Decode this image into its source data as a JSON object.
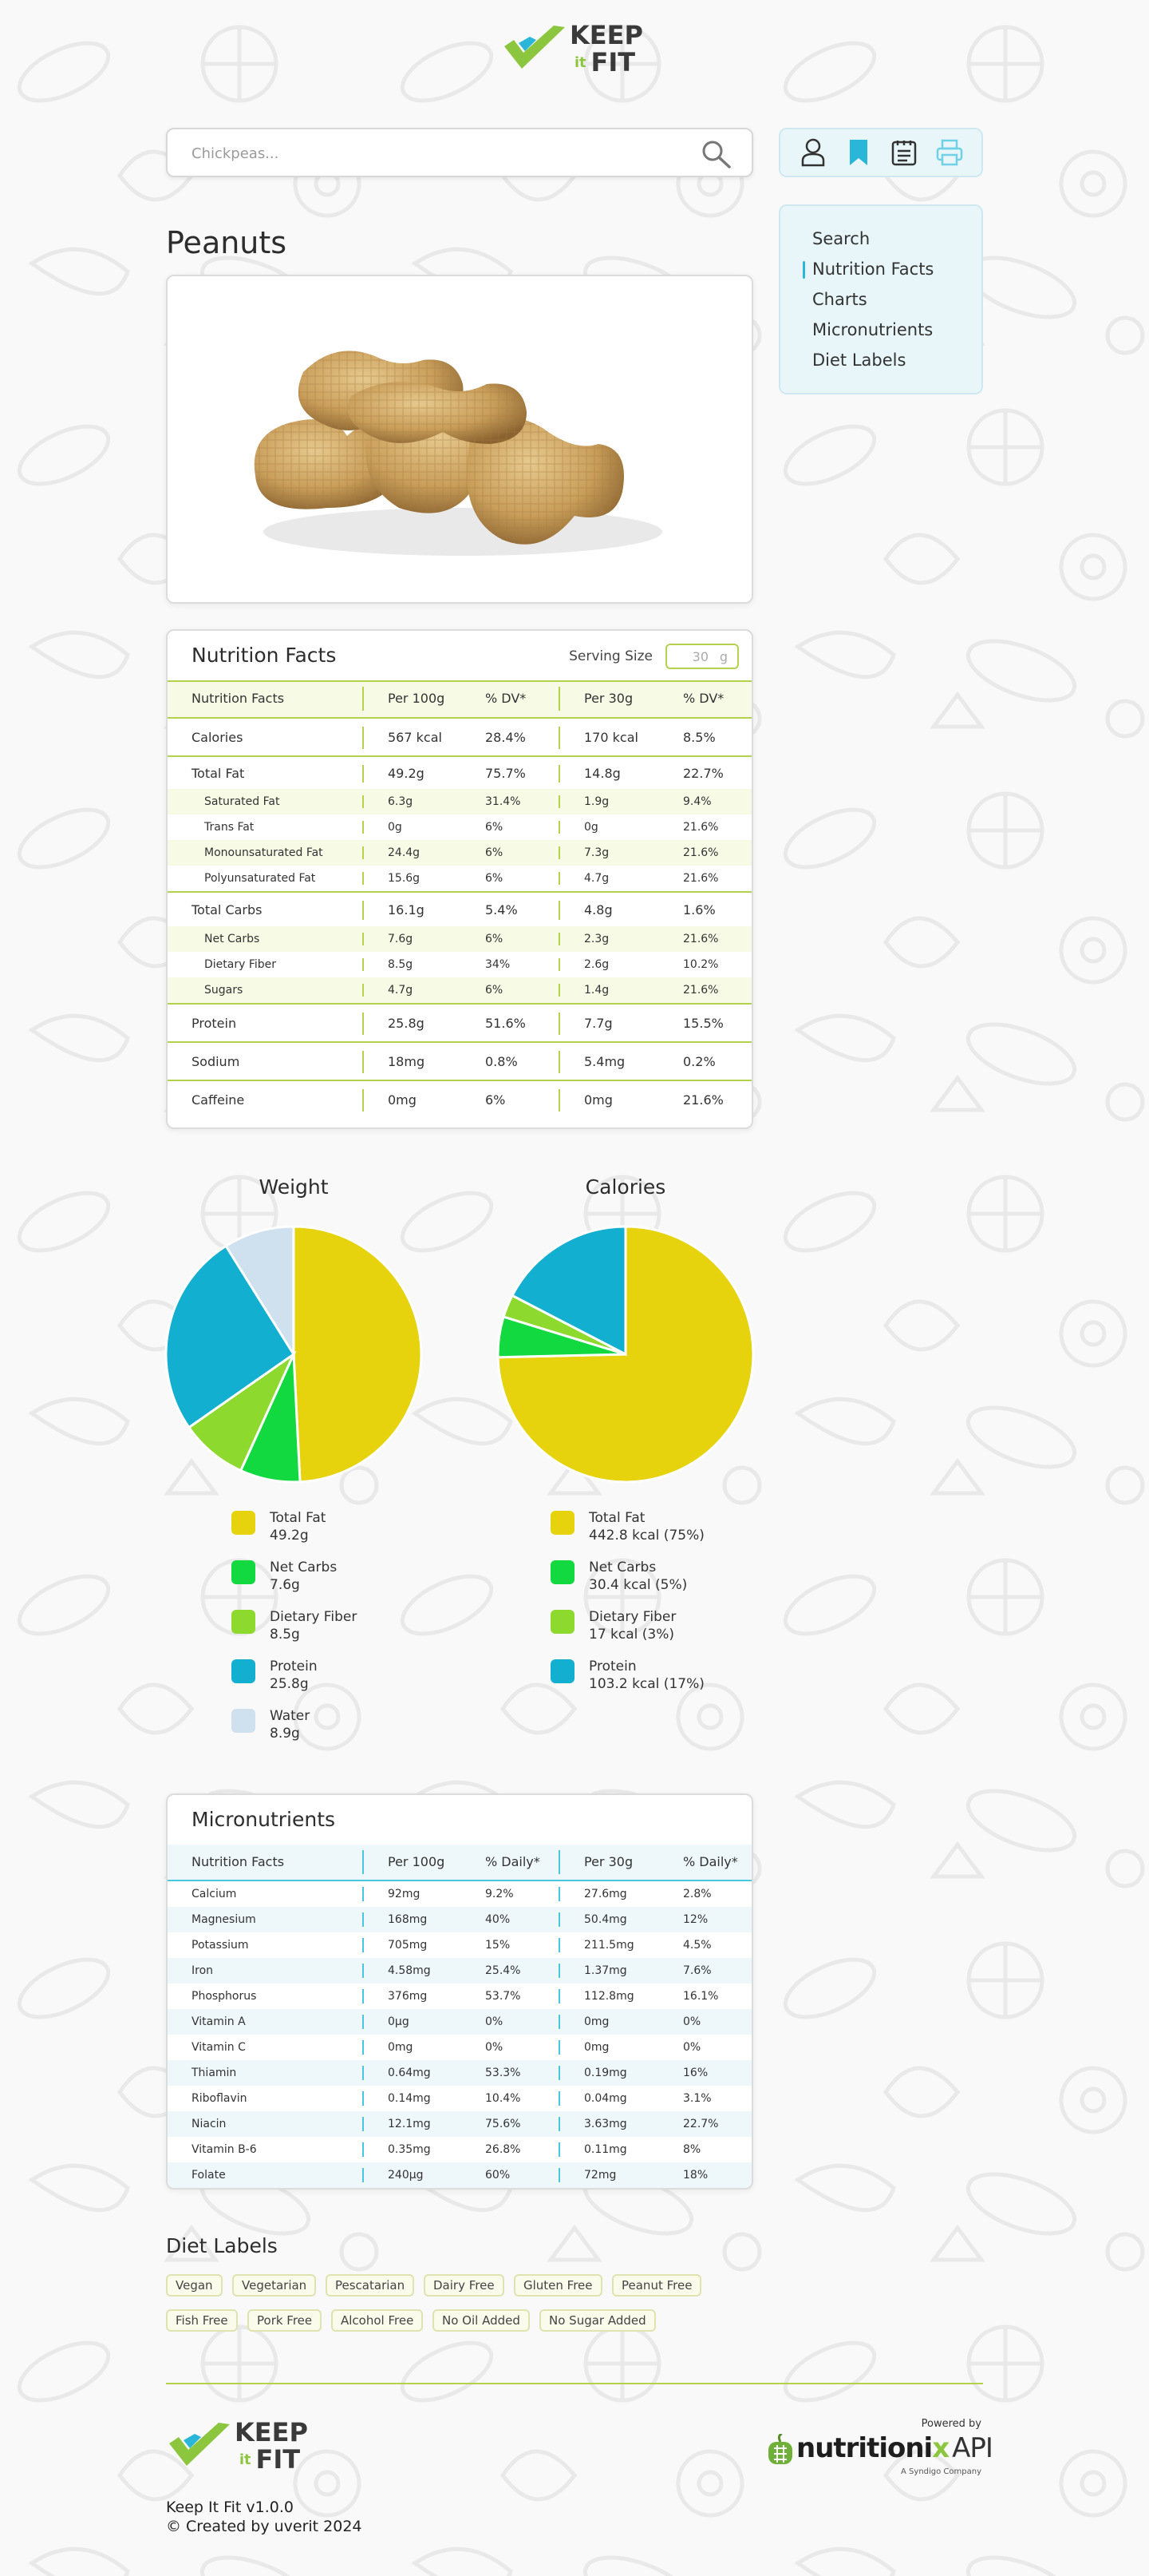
{
  "brand": {
    "word1": "KEEP",
    "word_it": "it",
    "word2": "FIT"
  },
  "search": {
    "placeholder": "Chickpeas..."
  },
  "toolbar": {
    "icons": [
      "user-icon",
      "bookmark-icon",
      "notes-icon",
      "print-icon"
    ]
  },
  "side_nav": {
    "items": [
      "Search",
      "Nutrition Facts",
      "Charts",
      "Micronutrients",
      "Diet Labels"
    ],
    "active": "Nutrition Facts"
  },
  "food": {
    "name": "Peanuts",
    "image": "peanuts-photo"
  },
  "nutrition": {
    "title": "Nutrition Facts",
    "serving_label": "Serving Size",
    "serving_value": "30",
    "serving_unit": "g",
    "header": [
      "Nutrition Facts",
      "Per 100g",
      "% DV*",
      "Per 30g",
      "% DV*"
    ],
    "rows": [
      [
        "Calories",
        "567 kcal",
        "28.4%",
        "170 kcal",
        "8.5%"
      ],
      [
        "Total Fat",
        "49.2g",
        "75.7%",
        "14.8g",
        "22.7%"
      ],
      [
        "Saturated Fat",
        "6.3g",
        "31.4%",
        "1.9g",
        "9.4%"
      ],
      [
        "Trans Fat",
        "0g",
        "6%",
        "0g",
        "21.6%"
      ],
      [
        "Monounsaturated Fat",
        "24.4g",
        "6%",
        "7.3g",
        "21.6%"
      ],
      [
        "Polyunsaturated Fat",
        "15.6g",
        "6%",
        "4.7g",
        "21.6%"
      ],
      [
        "Total Carbs",
        "16.1g",
        "5.4%",
        "4.8g",
        "1.6%"
      ],
      [
        "Net Carbs",
        "7.6g",
        "6%",
        "2.3g",
        "21.6%"
      ],
      [
        "Dietary Fiber",
        "8.5g",
        "34%",
        "2.6g",
        "10.2%"
      ],
      [
        "Sugars",
        "4.7g",
        "6%",
        "1.4g",
        "21.6%"
      ],
      [
        "Protein",
        "25.8g",
        "51.6%",
        "7.7g",
        "15.5%"
      ],
      [
        "Sodium",
        "18mg",
        "0.8%",
        "5.4mg",
        "0.2%"
      ],
      [
        "Caffeine",
        "0mg",
        "6%",
        "0mg",
        "21.6%"
      ]
    ]
  },
  "colors": {
    "fat": "#e6d20d",
    "net_carbs": "#12d93f",
    "fiber": "#8ed92e",
    "protein": "#12afd0",
    "water": "#cfe1ee",
    "accent_green": "#b5d24c",
    "accent_blue": "#49c6e0"
  },
  "chart_data": [
    {
      "type": "pie",
      "title": "Weight",
      "categories": [
        "Total Fat",
        "Net Carbs",
        "Dietary Fiber",
        "Protein",
        "Water"
      ],
      "values": [
        49.2,
        7.6,
        8.5,
        25.8,
        8.9
      ],
      "value_labels": [
        "49.2g",
        "7.6g",
        "8.5g",
        "25.8g",
        "8.9g"
      ],
      "colors": [
        "#e6d20d",
        "#12d93f",
        "#8ed92e",
        "#12afd0",
        "#cfe1ee"
      ]
    },
    {
      "type": "pie",
      "title": "Calories",
      "categories": [
        "Total Fat",
        "Net Carbs",
        "Dietary Fiber",
        "Protein"
      ],
      "values": [
        442.8,
        30.4,
        17,
        103.2
      ],
      "value_labels": [
        "442.8 kcal (75%)",
        "30.4 kcal (5%)",
        "17 kcal (3%)",
        "103.2 kcal (17%)"
      ],
      "colors": [
        "#e6d20d",
        "#12d93f",
        "#8ed92e",
        "#12afd0"
      ]
    }
  ],
  "micronutrients": {
    "title": "Micronutrients",
    "header": [
      "Nutrition Facts",
      "Per 100g",
      "% Daily*",
      "Per 30g",
      "% Daily*"
    ],
    "rows": [
      [
        "Calcium",
        "92mg",
        "9.2%",
        "27.6mg",
        "2.8%"
      ],
      [
        "Magnesium",
        "168mg",
        "40%",
        "50.4mg",
        "12%"
      ],
      [
        "Potassium",
        "705mg",
        "15%",
        "211.5mg",
        "4.5%"
      ],
      [
        "Iron",
        "4.58mg",
        "25.4%",
        "1.37mg",
        "7.6%"
      ],
      [
        "Phosphorus",
        "376mg",
        "53.7%",
        "112.8mg",
        "16.1%"
      ],
      [
        "Vitamin A",
        "0µg",
        "0%",
        "0mg",
        "0%"
      ],
      [
        "Vitamin C",
        "0mg",
        "0%",
        "0mg",
        "0%"
      ],
      [
        "Thiamin",
        "0.64mg",
        "53.3%",
        "0.19mg",
        "16%"
      ],
      [
        "Riboflavin",
        "0.14mg",
        "10.4%",
        "0.04mg",
        "3.1%"
      ],
      [
        "Niacin",
        "12.1mg",
        "75.6%",
        "3.63mg",
        "22.7%"
      ],
      [
        "Vitamin B-6",
        "0.35mg",
        "26.8%",
        "0.11mg",
        "8%"
      ],
      [
        "Folate",
        "240µg",
        "60%",
        "72mg",
        "18%"
      ]
    ]
  },
  "diet_labels": {
    "title": "Diet Labels",
    "tags": [
      "Vegan",
      "Vegetarian",
      "Pescatarian",
      "Dairy Free",
      "Gluten Free",
      "Peanut Free",
      "Fish Free",
      "Pork Free",
      "Alcohol Free",
      "No Oil Added",
      "No Sugar Added"
    ]
  },
  "footer": {
    "version": "Keep It Fit v1.0.0",
    "credit": "© Created by uverit 2024",
    "powered_by": "Powered by",
    "api_brand_a": "nutritioni",
    "api_brand_x": "x",
    "api_brand_b": "API",
    "api_sub": "A Syndigo Company"
  }
}
